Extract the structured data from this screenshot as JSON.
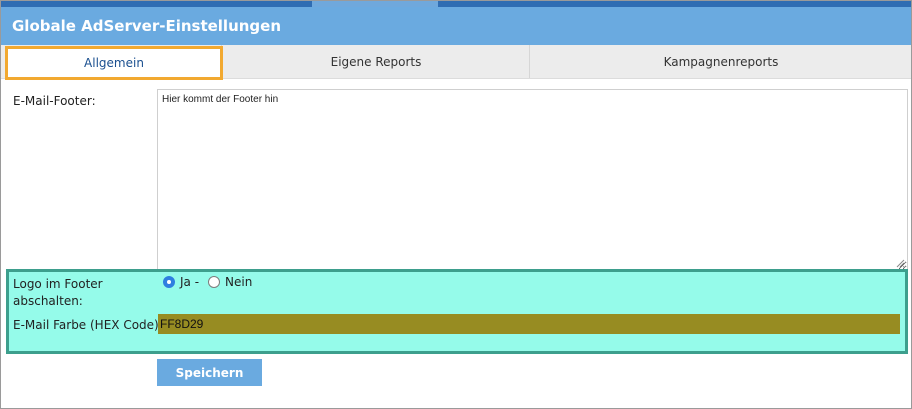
{
  "header": {
    "title": "Globale AdServer-Einstellungen"
  },
  "tabs": [
    {
      "label": "Allgemein",
      "active": true
    },
    {
      "label": "Eigene Reports",
      "active": false
    },
    {
      "label": "Kampagnenreports",
      "active": false
    }
  ],
  "form": {
    "email_footer_label": "E-Mail-Footer:",
    "email_footer_value": "Hier kommt der Footer hin",
    "logo_label_line1": "Logo im Footer",
    "logo_label_line2": "abschalten:",
    "radio_yes_label": "Ja -",
    "radio_no_label": "Nein",
    "radio_selected": "Ja",
    "color_label": "E-Mail Farbe (HEX Code):",
    "color_value": "FF8D29",
    "save_label": "Speichern"
  },
  "colors": {
    "header_bg": "#6aaae0",
    "active_tab_outline": "#f2a930",
    "highlight_bg": "#95fbea",
    "highlight_border": "#3d9f8d",
    "color_field_bg": "#978c22",
    "save_button_bg": "#6aaae0"
  },
  "icons": {
    "resize": "resize-grip-icon"
  }
}
